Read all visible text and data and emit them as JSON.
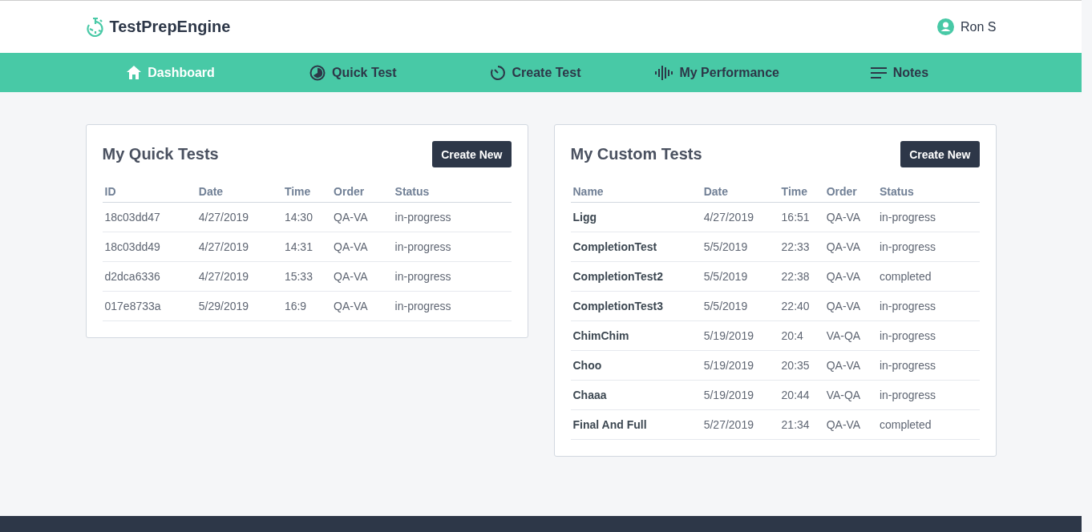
{
  "brand": {
    "name": "TestPrepEngine"
  },
  "user": {
    "name": "Ron S"
  },
  "nav": [
    {
      "label": "Dashboard",
      "kind": "home",
      "selected": true
    },
    {
      "label": "Quick Test",
      "kind": "quick",
      "selected": false
    },
    {
      "label": "Create Test",
      "kind": "timer",
      "selected": false
    },
    {
      "label": "My Performance",
      "kind": "wave",
      "selected": false
    },
    {
      "label": "Notes",
      "kind": "notes",
      "selected": false
    }
  ],
  "panels": [
    {
      "title": "My Quick Tests",
      "button": "Create New",
      "first_column_emphasis": false,
      "columns": [
        "ID",
        "Date",
        "Time",
        "Order",
        "Status"
      ],
      "rows": [
        [
          "18c03dd47",
          "4/27/2019",
          "14:30",
          "QA-VA",
          "in-progress"
        ],
        [
          "18c03dd49",
          "4/27/2019",
          "14:31",
          "QA-VA",
          "in-progress"
        ],
        [
          "d2dca6336",
          "4/27/2019",
          "15:33",
          "QA-VA",
          "in-progress"
        ],
        [
          "017e8733a",
          "5/29/2019",
          "16:9",
          "QA-VA",
          "in-progress"
        ]
      ]
    },
    {
      "title": "My Custom Tests",
      "button": "Create New",
      "first_column_emphasis": true,
      "columns": [
        "Name",
        "Date",
        "Time",
        "Order",
        "Status"
      ],
      "rows": [
        [
          "Ligg",
          "4/27/2019",
          "16:51",
          "QA-VA",
          "in-progress"
        ],
        [
          "CompletionTest",
          "5/5/2019",
          "22:33",
          "QA-VA",
          "in-progress"
        ],
        [
          "CompletionTest2",
          "5/5/2019",
          "22:38",
          "QA-VA",
          "completed"
        ],
        [
          "CompletionTest3",
          "5/5/2019",
          "22:40",
          "QA-VA",
          "in-progress"
        ],
        [
          "ChimChim",
          "5/19/2019",
          "20:4",
          "VA-QA",
          "in-progress"
        ],
        [
          "Choo",
          "5/19/2019",
          "20:35",
          "QA-VA",
          "in-progress"
        ],
        [
          "Chaaa",
          "5/19/2019",
          "20:44",
          "VA-QA",
          "in-progress"
        ],
        [
          "Final And Full",
          "5/27/2019",
          "21:34",
          "QA-VA",
          "completed"
        ]
      ]
    }
  ]
}
